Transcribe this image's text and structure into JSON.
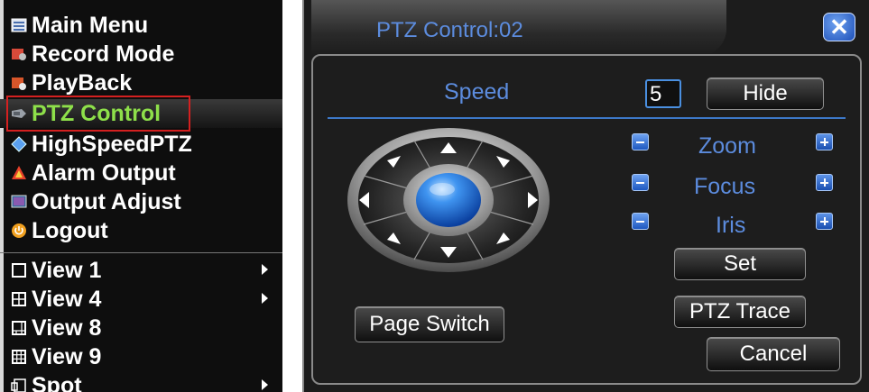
{
  "menu": {
    "items": [
      {
        "label": "Main Menu",
        "icon": "main-menu-icon"
      },
      {
        "label": "Record Mode",
        "icon": "record-mode-icon"
      },
      {
        "label": "PlayBack",
        "icon": "playback-icon"
      },
      {
        "label": "PTZ Control",
        "icon": "ptz-control-icon",
        "active": true
      },
      {
        "label": "HighSpeedPTZ",
        "icon": "highspeed-ptz-icon"
      },
      {
        "label": "Alarm Output",
        "icon": "alarm-output-icon"
      },
      {
        "label": "Output Adjust",
        "icon": "output-adjust-icon"
      },
      {
        "label": "Logout",
        "icon": "logout-icon"
      },
      {
        "label": "View 1",
        "icon": "view-1-icon",
        "submenu": true
      },
      {
        "label": "View 4",
        "icon": "view-4-icon",
        "submenu": true
      },
      {
        "label": "View 8",
        "icon": "view-8-icon"
      },
      {
        "label": "View 9",
        "icon": "view-9-icon"
      },
      {
        "label": "Spot",
        "icon": "spot-icon",
        "submenu": true
      }
    ]
  },
  "dialog": {
    "title": "PTZ Control:02",
    "speed_label": "Speed",
    "speed_value": "5",
    "hide_button": "Hide",
    "zoom_label": "Zoom",
    "focus_label": "Focus",
    "iris_label": "Iris",
    "set_button": "Set",
    "ptz_trace_button": "PTZ Trace",
    "page_switch_button": "Page Switch",
    "cancel_button": "Cancel",
    "close_icon": "close-icon"
  },
  "colors": {
    "label_blue": "#5c8cde",
    "active_green": "#8ee04a",
    "highlight_red": "#d42020"
  }
}
